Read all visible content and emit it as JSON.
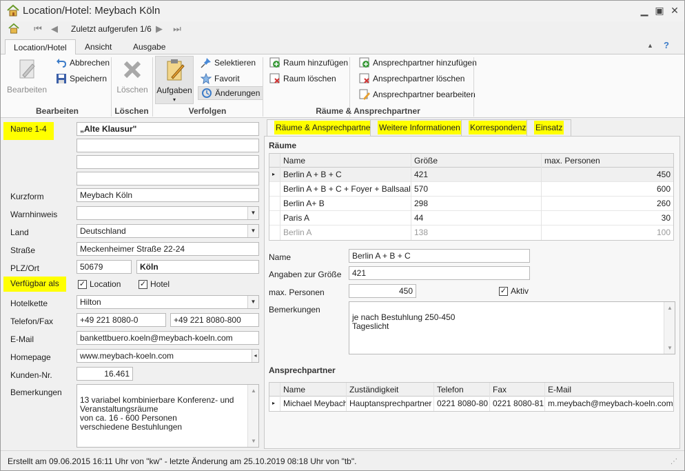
{
  "window": {
    "title": "Location/Hotel: Meybach Köln"
  },
  "qat": {
    "recent": "Zuletzt aufgerufen 1/6"
  },
  "ribbon_tabs": [
    "Location/Hotel",
    "Ansicht",
    "Ausgabe"
  ],
  "ribbon": {
    "bearbeiten_btn": "Bearbeiten",
    "abbrechen": "Abbrechen",
    "speichern": "Speichern",
    "loeschen_btn": "Löschen",
    "aufgaben": "Aufgaben",
    "selektieren": "Selektieren",
    "favorit": "Favorit",
    "aenderungen": "Änderungen",
    "raum_hinzu": "Raum hinzufügen",
    "raum_loeschen": "Raum löschen",
    "ap_hinzu": "Ansprechpartner hinzufügen",
    "ap_loeschen": "Ansprechpartner löschen",
    "ap_bearbeiten": "Ansprechpartner bearbeiten",
    "groups": {
      "bearbeiten": "Bearbeiten",
      "loeschen": "Löschen",
      "verfolgen": "Verfolgen",
      "raeume": "Räume & Ansprechpartner"
    }
  },
  "form": {
    "name_label": "Name 1-4",
    "name1": "„Alte Klausur\"",
    "name2": "",
    "name3": "",
    "name4": "",
    "kurzform_label": "Kurzform",
    "kurzform": "Meybach Köln",
    "warnhinweis_label": "Warnhinweis",
    "warnhinweis": "",
    "land_label": "Land",
    "land": "Deutschland",
    "strasse_label": "Straße",
    "strasse": "Meckenheimer Straße 22-24",
    "plzort_label": "PLZ/Ort",
    "plz": "50679",
    "ort": "Köln",
    "verfuegbar_label": "Verfügbar als",
    "chk_location": "Location",
    "chk_hotel": "Hotel",
    "hotelkette_label": "Hotelkette",
    "hotelkette": "Hilton",
    "telefon_label": "Telefon/Fax",
    "telefon": "+49 221 8080-0",
    "fax": "+49 221 8080-800",
    "email_label": "E-Mail",
    "email": "bankettbuero.koeln@meybach-koeln.com",
    "homepage_label": "Homepage",
    "homepage": "www.meybach-koeln.com",
    "kunden_label": "Kunden-Nr.",
    "kunden": "16.461",
    "bemerkungen_label": "Bemerkungen",
    "bemerkungen": "13 variabel kombinierbare Konferenz- und\nVeranstaltungsräume\nvon ca. 16 - 600 Personen\nverschiedene Bestuhlungen"
  },
  "right_tabs": [
    "Räume & Ansprechpartner",
    "Weitere Informationen",
    "Korrespondenz",
    "Einsatz"
  ],
  "raeume": {
    "title": "Räume",
    "columns": [
      "Name",
      "Größe",
      "max. Personen"
    ],
    "rows": [
      [
        "Berlin A + B + C",
        "421",
        "450"
      ],
      [
        "Berlin A + B + C + Foyer + Ballsaal",
        "570",
        "600"
      ],
      [
        "Berlin A+ B",
        "298",
        "260"
      ],
      [
        "Paris A",
        "44",
        "30"
      ],
      [
        "Berlin A",
        "138",
        "100"
      ]
    ]
  },
  "detail": {
    "name_label": "Name",
    "name": "Berlin A + B + C",
    "groesse_label": "Angaben zur Größe",
    "groesse": "421",
    "maxp_label": "max. Personen",
    "maxp": "450",
    "aktiv": "Aktiv",
    "bem_label": "Bemerkungen",
    "bem": "je nach Bestuhlung 250-450\nTageslicht"
  },
  "ansprechpartner": {
    "title": "Ansprechpartner",
    "columns": [
      "Name",
      "Zuständigkeit",
      "Telefon",
      "Fax",
      "E-Mail"
    ],
    "rows": [
      [
        "Michael Meybach",
        "Hauptansprechpartner",
        "0221 8080-80",
        "0221 8080-81",
        "m.meybach@meybach-koeln.com"
      ]
    ]
  },
  "status": "Erstellt am 09.06.2015 16:11 Uhr von \"kw\" - letzte Änderung am 25.10.2019 08:18 Uhr von \"tb\".",
  "colors": {
    "highlight": "#ffff00",
    "accent": "#3b7bc8"
  }
}
